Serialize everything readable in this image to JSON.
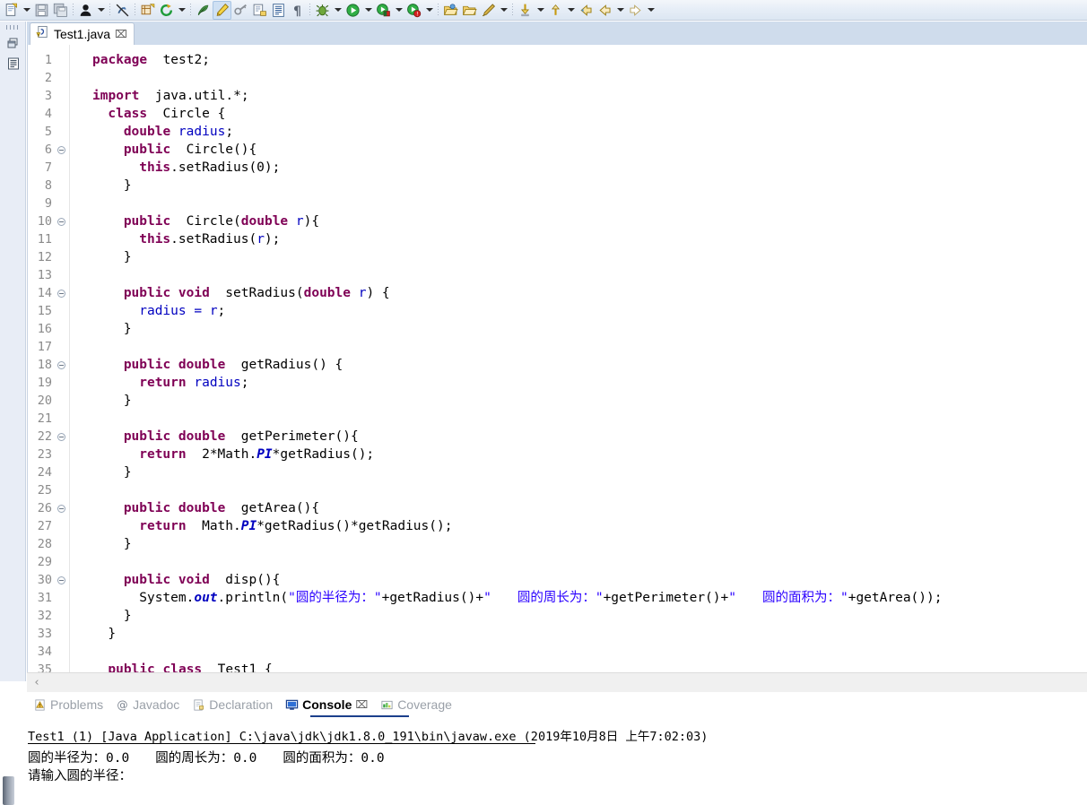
{
  "toolbar": {
    "items": [
      {
        "icon": "new-file-icon",
        "label": "New",
        "dropdown": true,
        "pressed": false
      },
      {
        "icon": "save-icon",
        "label": "Save",
        "dropdown": false,
        "pressed": false
      },
      {
        "icon": "save-all-icon",
        "label": "Save All",
        "dropdown": false,
        "pressed": false
      },
      {
        "sep": true
      },
      {
        "icon": "user-person-icon",
        "label": "Open Task",
        "dropdown": true,
        "pressed": false
      },
      {
        "sep": true
      },
      {
        "icon": "no-link-icon",
        "label": "Link With Editor",
        "dropdown": false,
        "pressed": false
      },
      {
        "sep": true
      },
      {
        "icon": "new-java-package-icon",
        "label": "New Java Package",
        "dropdown": false,
        "pressed": false
      },
      {
        "icon": "refresh-green-icon",
        "label": "Refresh",
        "dropdown": true,
        "pressed": false
      },
      {
        "sep": true
      },
      {
        "icon": "annotation-icon",
        "label": "Next Annotation",
        "dropdown": false,
        "pressed": false
      },
      {
        "icon": "highlight-pen-icon",
        "label": "Toggle Mark Occurrences",
        "dropdown": false,
        "pressed": true
      },
      {
        "icon": "key-tools-icon",
        "label": "Key Assist",
        "dropdown": false,
        "pressed": false
      },
      {
        "icon": "open-type-icon",
        "label": "Open Type",
        "dropdown": false,
        "pressed": false
      },
      {
        "icon": "open-task-list-icon",
        "label": "Open Task",
        "dropdown": false,
        "pressed": false
      },
      {
        "icon": "pilcrow-icon",
        "label": "Show Whitespace",
        "dropdown": false,
        "pressed": false
      },
      {
        "sep": true
      },
      {
        "icon": "debug-bug-icon",
        "label": "Debug",
        "dropdown": true,
        "pressed": false
      },
      {
        "icon": "run-green-icon",
        "label": "Run",
        "dropdown": true,
        "pressed": false
      },
      {
        "icon": "coverage-icon",
        "label": "Coverage",
        "dropdown": true,
        "pressed": false
      },
      {
        "icon": "external-tools-icon",
        "label": "External Tools",
        "dropdown": true,
        "pressed": false
      },
      {
        "sep": true
      },
      {
        "icon": "open-folder-icon",
        "label": "Open Resource",
        "dropdown": false,
        "pressed": false
      },
      {
        "icon": "folder-out-icon",
        "label": "Export",
        "dropdown": false,
        "pressed": false
      },
      {
        "icon": "search-pencil-icon",
        "label": "Search",
        "dropdown": true,
        "pressed": false
      },
      {
        "sep": true
      },
      {
        "icon": "last-edit-yellow-icon",
        "label": "Last Edit Location",
        "dropdown": true,
        "pressed": false
      },
      {
        "icon": "up-arrow-yellow-icon",
        "label": "Go to Previous",
        "dropdown": true,
        "pressed": false
      },
      {
        "icon": "back-arrow-icon",
        "label": "Back",
        "dropdown": false,
        "pressed": false
      },
      {
        "icon": "back-arrow2-icon",
        "label": "Back History",
        "dropdown": true,
        "pressed": false
      },
      {
        "icon": "forward-arrow-icon",
        "label": "Forward",
        "dropdown": true,
        "pressed": false
      }
    ]
  },
  "left_rail": {
    "buttons": [
      {
        "icon": "restore-view-icon",
        "label": "Restore"
      },
      {
        "icon": "outline-view-icon",
        "label": "Outline"
      }
    ]
  },
  "editor": {
    "tab": {
      "icon": "java-file-warning-icon",
      "label": "Test1.java",
      "close": "⌧"
    },
    "scroll_left_arrow": "‹",
    "lines": [
      {
        "n": 1,
        "fold": false,
        "indent": 0,
        "tokens": [
          [
            "kw",
            "package"
          ],
          [
            "",
            "  test2;"
          ]
        ]
      },
      {
        "n": 2,
        "fold": false,
        "indent": 0,
        "tokens": [
          [
            "",
            ""
          ]
        ]
      },
      {
        "n": 3,
        "fold": false,
        "indent": 0,
        "tokens": [
          [
            "kw",
            "import"
          ],
          [
            "",
            "  java.util.*;"
          ]
        ]
      },
      {
        "n": 4,
        "fold": false,
        "indent": 1,
        "tokens": [
          [
            "kw",
            "class"
          ],
          [
            "",
            "  Circle {"
          ]
        ]
      },
      {
        "n": 5,
        "fold": false,
        "indent": 2,
        "tokens": [
          [
            "kw",
            "double"
          ],
          [
            "",
            ""
          ],
          [
            "fld",
            " radius"
          ],
          [
            "",
            ";"
          ]
        ]
      },
      {
        "n": 6,
        "fold": true,
        "indent": 2,
        "tokens": [
          [
            "kw",
            "public"
          ],
          [
            "",
            "  Circle(){"
          ]
        ]
      },
      {
        "n": 7,
        "fold": false,
        "indent": 3,
        "tokens": [
          [
            "kw",
            "this"
          ],
          [
            "",
            ".setRadius(0);"
          ]
        ]
      },
      {
        "n": 8,
        "fold": false,
        "indent": 2,
        "tokens": [
          [
            "",
            "}"
          ]
        ]
      },
      {
        "n": 9,
        "fold": false,
        "indent": 0,
        "tokens": [
          [
            "",
            ""
          ]
        ]
      },
      {
        "n": 10,
        "fold": true,
        "indent": 2,
        "tokens": [
          [
            "kw",
            "public"
          ],
          [
            "",
            "  Circle("
          ],
          [
            "kw",
            "double"
          ],
          [
            "",
            ""
          ],
          [
            "fld",
            " r"
          ],
          [
            "",
            "){"
          ]
        ]
      },
      {
        "n": 11,
        "fold": false,
        "indent": 3,
        "tokens": [
          [
            "kw",
            "this"
          ],
          [
            "",
            ".setRadius("
          ],
          [
            "fld",
            "r"
          ],
          [
            "",
            ");"
          ]
        ]
      },
      {
        "n": 12,
        "fold": false,
        "indent": 2,
        "tokens": [
          [
            "",
            "}"
          ]
        ]
      },
      {
        "n": 13,
        "fold": false,
        "indent": 0,
        "tokens": [
          [
            "",
            ""
          ]
        ]
      },
      {
        "n": 14,
        "fold": true,
        "indent": 2,
        "tokens": [
          [
            "kw",
            "public void"
          ],
          [
            "",
            "  setRadius("
          ],
          [
            "kw",
            "double"
          ],
          [
            "",
            ""
          ],
          [
            "fld",
            " r"
          ],
          [
            "",
            ") {"
          ]
        ]
      },
      {
        "n": 15,
        "fold": false,
        "indent": 3,
        "tokens": [
          [
            "fld",
            "radius"
          ],
          [
            "",
            ""
          ],
          [
            "fld",
            " = r"
          ],
          [
            "",
            ";"
          ]
        ]
      },
      {
        "n": 16,
        "fold": false,
        "indent": 2,
        "tokens": [
          [
            "",
            "}"
          ]
        ]
      },
      {
        "n": 17,
        "fold": false,
        "indent": 0,
        "tokens": [
          [
            "",
            ""
          ]
        ]
      },
      {
        "n": 18,
        "fold": true,
        "indent": 2,
        "tokens": [
          [
            "kw",
            "public double"
          ],
          [
            "",
            "  getRadius() {"
          ]
        ]
      },
      {
        "n": 19,
        "fold": false,
        "indent": 3,
        "tokens": [
          [
            "kw",
            "return"
          ],
          [
            "",
            ""
          ],
          [
            "fld",
            " radius"
          ],
          [
            "",
            ";"
          ]
        ]
      },
      {
        "n": 20,
        "fold": false,
        "indent": 2,
        "tokens": [
          [
            "",
            "}"
          ]
        ]
      },
      {
        "n": 21,
        "fold": false,
        "indent": 0,
        "tokens": [
          [
            "",
            ""
          ]
        ]
      },
      {
        "n": 22,
        "fold": true,
        "indent": 2,
        "tokens": [
          [
            "kw",
            "public double"
          ],
          [
            "",
            "  getPerimeter(){"
          ]
        ]
      },
      {
        "n": 23,
        "fold": false,
        "indent": 3,
        "tokens": [
          [
            "kw",
            "return"
          ],
          [
            "",
            "  2*Math."
          ],
          [
            "stat",
            "PI"
          ],
          [
            "",
            "*getRadius();"
          ]
        ]
      },
      {
        "n": 24,
        "fold": false,
        "indent": 2,
        "tokens": [
          [
            "",
            "}"
          ]
        ]
      },
      {
        "n": 25,
        "fold": false,
        "indent": 0,
        "tokens": [
          [
            "",
            ""
          ]
        ]
      },
      {
        "n": 26,
        "fold": true,
        "indent": 2,
        "tokens": [
          [
            "kw",
            "public double"
          ],
          [
            "",
            "  getArea(){"
          ]
        ]
      },
      {
        "n": 27,
        "fold": false,
        "indent": 3,
        "tokens": [
          [
            "kw",
            "return"
          ],
          [
            "",
            "  Math."
          ],
          [
            "stat",
            "PI"
          ],
          [
            "",
            "*getRadius()*getRadius();"
          ]
        ]
      },
      {
        "n": 28,
        "fold": false,
        "indent": 2,
        "tokens": [
          [
            "",
            "}"
          ]
        ]
      },
      {
        "n": 29,
        "fold": false,
        "indent": 0,
        "tokens": [
          [
            "",
            ""
          ]
        ]
      },
      {
        "n": 30,
        "fold": true,
        "indent": 2,
        "tokens": [
          [
            "kw",
            "public void"
          ],
          [
            "",
            "  disp(){"
          ]
        ]
      },
      {
        "n": 31,
        "fold": false,
        "indent": 3,
        "tokens": [
          [
            "",
            "System."
          ],
          [
            "stat",
            "out"
          ],
          [
            "",
            ".println("
          ],
          [
            "str",
            "\"圆的半径为：\""
          ],
          [
            "",
            "+getRadius()+"
          ],
          [
            "str",
            "\"　　圆的周长为：\""
          ],
          [
            "",
            "+getPerimeter()+"
          ],
          [
            "str",
            "\"　　圆的面积为：\""
          ],
          [
            "",
            "+getArea());"
          ]
        ]
      },
      {
        "n": 32,
        "fold": false,
        "indent": 2,
        "tokens": [
          [
            "",
            "}"
          ]
        ]
      },
      {
        "n": 33,
        "fold": false,
        "indent": 1,
        "tokens": [
          [
            "",
            "}"
          ]
        ]
      },
      {
        "n": 34,
        "fold": false,
        "indent": 0,
        "tokens": [
          [
            "",
            ""
          ]
        ]
      },
      {
        "n": 35,
        "fold": false,
        "indent": 1,
        "tokens": [
          [
            "kw",
            "public class"
          ],
          [
            "",
            "  Test1 {"
          ]
        ]
      }
    ]
  },
  "bottom_panel": {
    "tabs": [
      {
        "label": "Problems",
        "icon": "problems-icon",
        "active": false,
        "closable": false
      },
      {
        "label": "Javadoc",
        "icon": "javadoc-at-icon",
        "active": false,
        "closable": false
      },
      {
        "label": "Declaration",
        "icon": "declaration-icon",
        "active": false,
        "closable": false
      },
      {
        "label": "Console",
        "icon": "console-icon",
        "active": true,
        "closable": true
      },
      {
        "label": "Coverage",
        "icon": "coverage-tab-icon",
        "active": false,
        "closable": false
      }
    ],
    "close_glyph": "⌧",
    "console": {
      "launch_line": "Test1 (1) [Java Application] C:\\java\\jdk\\jdk1.8.0_191\\bin\\javaw.exe (2019年10月8日 上午7:02:03)",
      "output": [
        "圆的半径为：0.0　　圆的周长为：0.0　　圆的面积为：0.0",
        "请输入圆的半径："
      ]
    }
  },
  "colors": {
    "keyword": "#7f0055",
    "field": "#0000c0",
    "string": "#2a00ff",
    "tabbar_bg": "#cfdcec",
    "active_tab_underline": "#1b3f8b"
  }
}
